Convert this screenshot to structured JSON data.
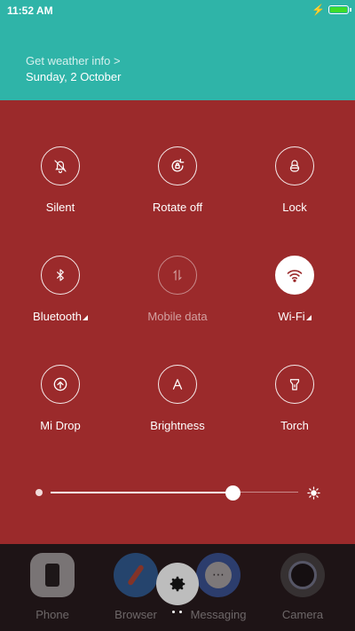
{
  "status_bar": {
    "time": "11:52 AM",
    "battery_level": 1.0,
    "battery_color": "#3ddc2a",
    "charging_icon": "lightning-icon"
  },
  "header": {
    "weather_link": "Get weather info >",
    "date": "Sunday, 2 October",
    "color": "#2fb4a8"
  },
  "panel": {
    "color": "#9b2a2b"
  },
  "tiles": [
    {
      "label": "Silent",
      "icon": "bell-off-icon",
      "state": "off"
    },
    {
      "label": "Rotate off",
      "icon": "rotate-lock-icon",
      "state": "off"
    },
    {
      "label": "Lock",
      "icon": "lock-icon",
      "state": "off"
    },
    {
      "label": "Bluetooth",
      "icon": "bluetooth-icon",
      "state": "off",
      "has_menu": true
    },
    {
      "label": "Mobile data",
      "icon": "mobile-data-icon",
      "state": "disabled"
    },
    {
      "label": "Wi-Fi",
      "icon": "wifi-icon",
      "state": "on",
      "has_menu": true
    },
    {
      "label": "Mi Drop",
      "icon": "mi-drop-icon",
      "state": "off"
    },
    {
      "label": "Brightness",
      "icon": "brightness-auto-icon",
      "state": "off"
    },
    {
      "label": "Torch",
      "icon": "torch-icon",
      "state": "off"
    }
  ],
  "brightness": {
    "level": 0.73
  },
  "dock": {
    "apps": [
      {
        "label": "Phone",
        "icon": "phone-app-icon"
      },
      {
        "label": "Browser",
        "icon": "browser-app-icon"
      },
      {
        "label": "Messaging",
        "icon": "messaging-app-icon"
      },
      {
        "label": "Camera",
        "icon": "camera-app-icon"
      }
    ],
    "settings_icon": "gear-icon"
  }
}
